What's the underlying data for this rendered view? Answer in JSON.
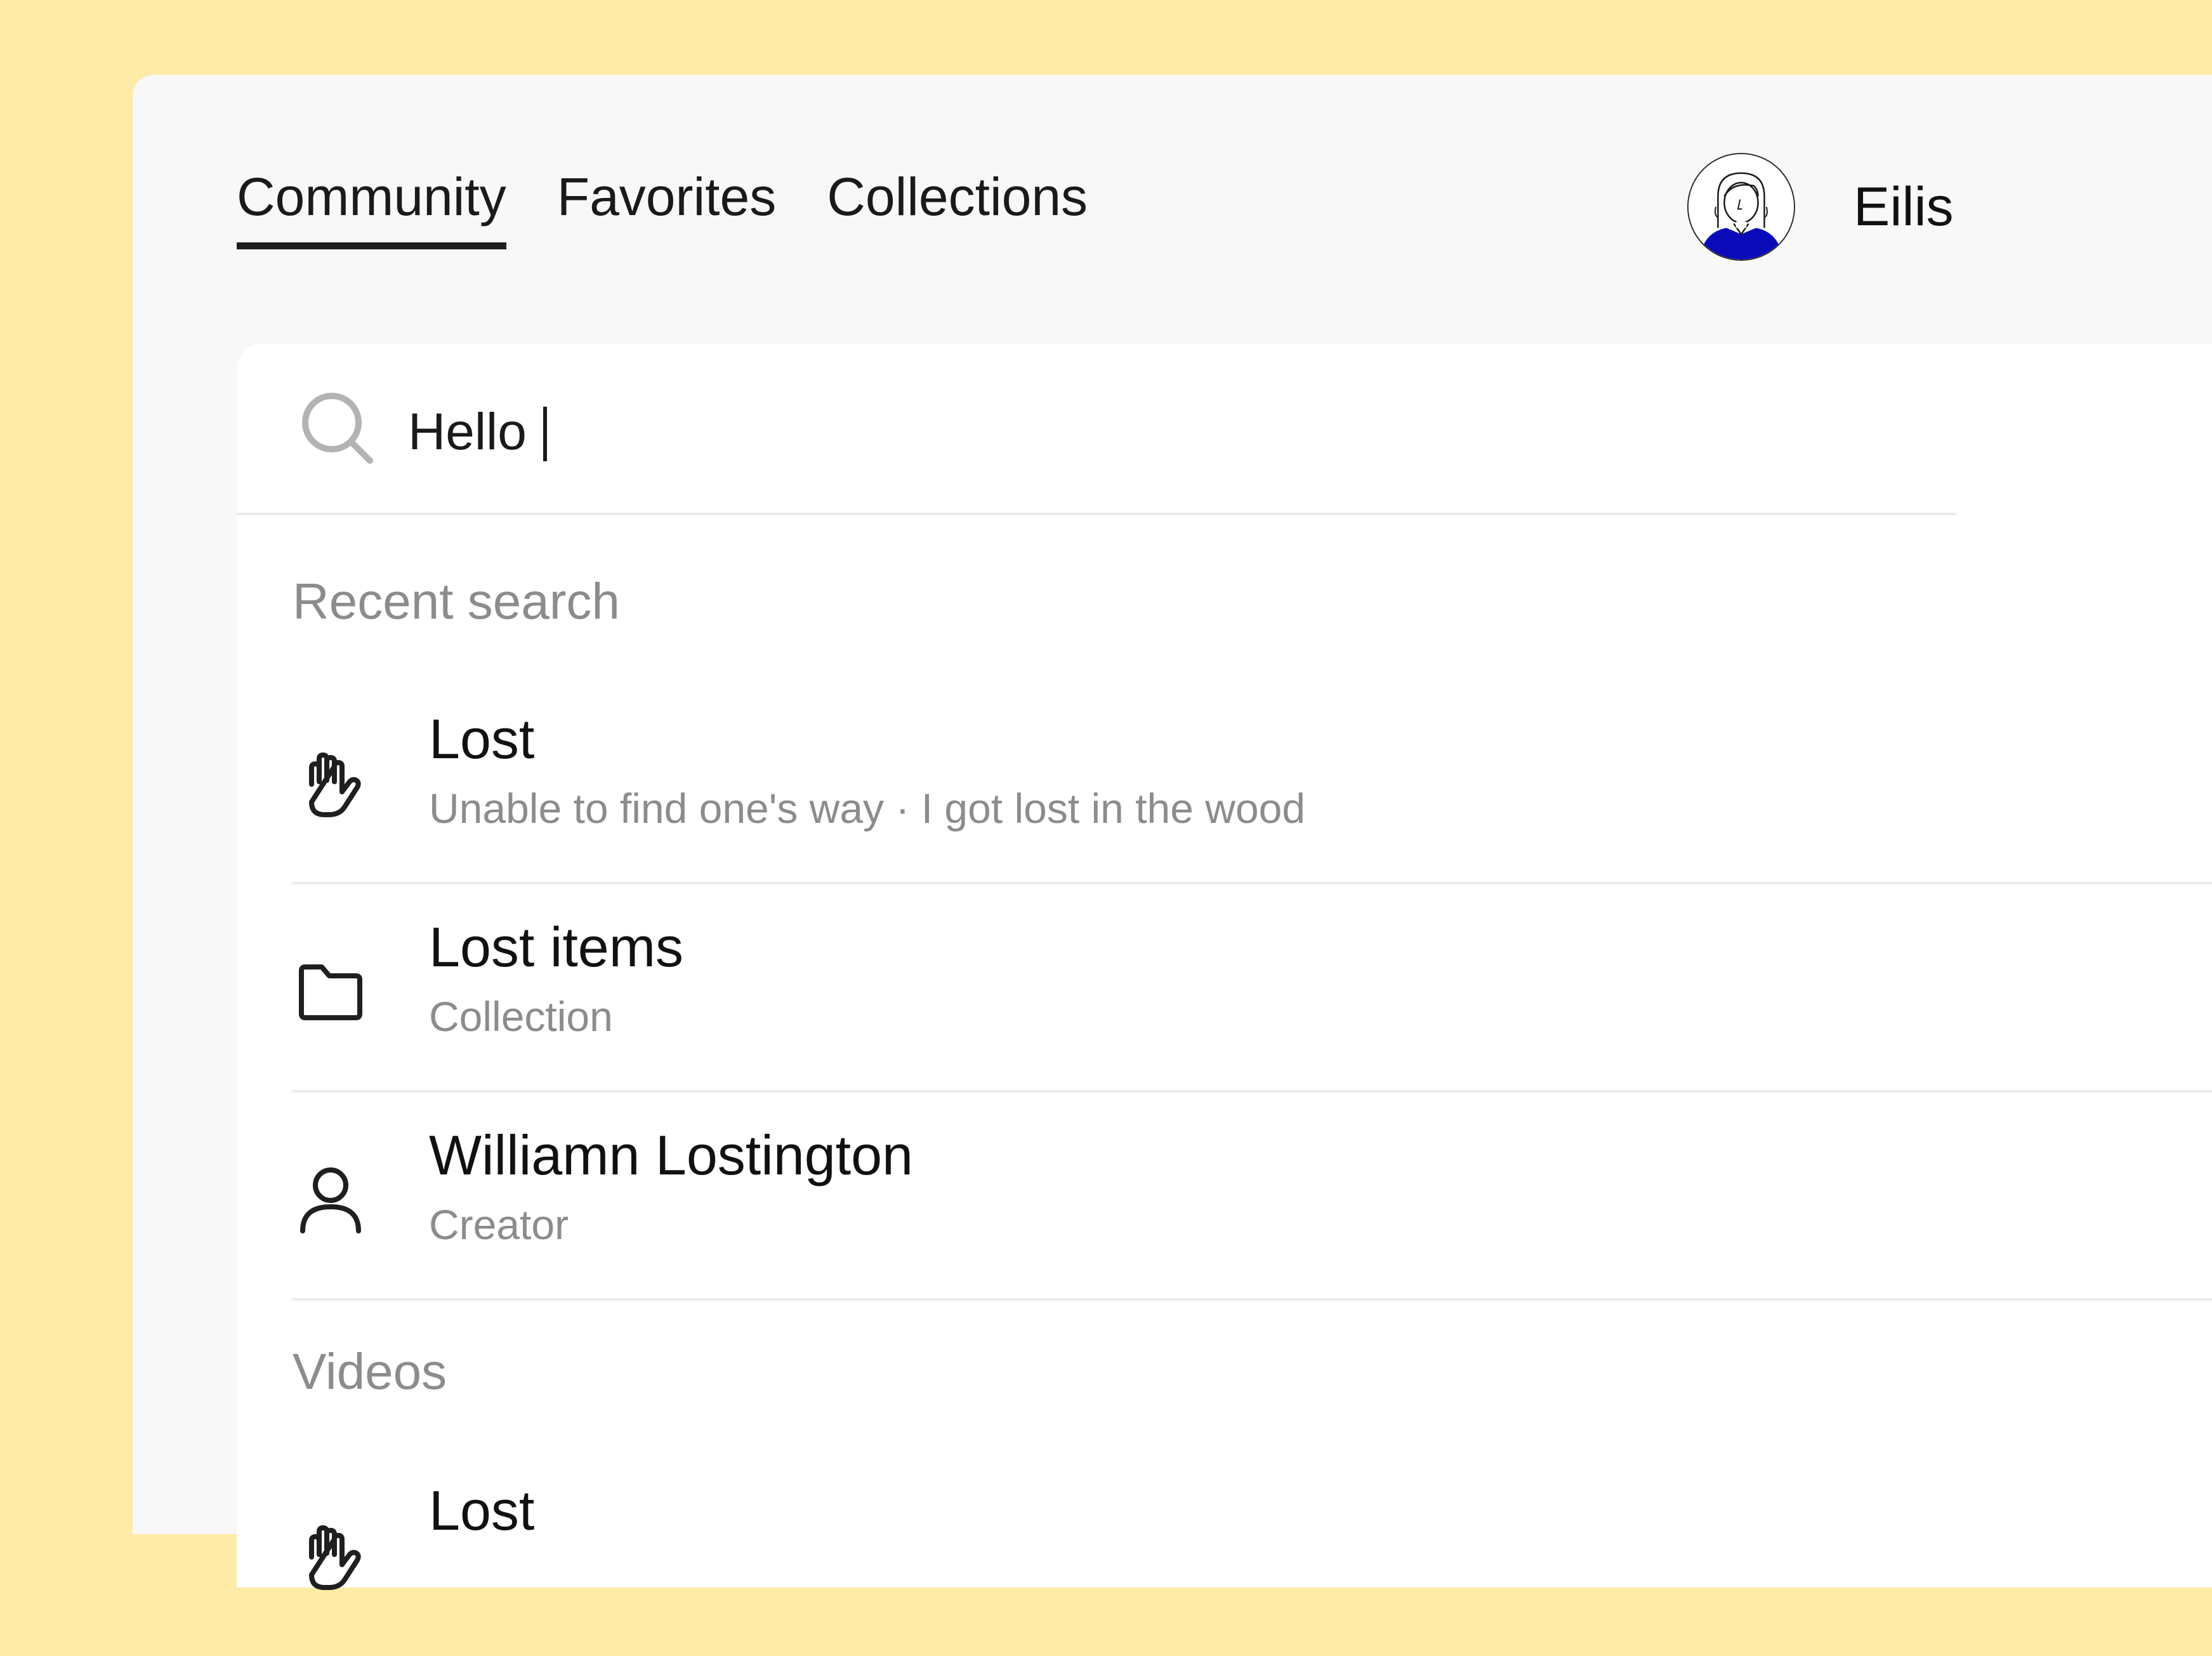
{
  "nav": {
    "tabs": [
      {
        "label": "Community",
        "active": true
      },
      {
        "label": "Favorites",
        "active": false
      },
      {
        "label": "Collections",
        "active": false
      }
    ]
  },
  "user": {
    "name": "Eilis",
    "avatar_icon": "avatar-illustration"
  },
  "search": {
    "value": "Hello ",
    "icon": "search-icon"
  },
  "sections": {
    "recent_label": "Recent search",
    "videos_label": "Videos"
  },
  "recent_items": [
    {
      "icon": "hand-icon",
      "title": "Lost",
      "subtitle": "Unable to find one's way · I got lost in the wood"
    },
    {
      "icon": "folder-icon",
      "title": "Lost items",
      "subtitle": "Collection"
    },
    {
      "icon": "user-icon",
      "title": "Williamn Lostington",
      "subtitle": "Creator"
    }
  ],
  "video_items": [
    {
      "icon": "hand-icon",
      "title": "Lost"
    }
  ],
  "colors": {
    "background": "#FFEBA8",
    "window": "#F8F8F8",
    "panel": "#FFFFFF",
    "text_primary": "#111111",
    "text_secondary": "#8C8C8C",
    "avatar_accent": "#0A0AB8"
  }
}
